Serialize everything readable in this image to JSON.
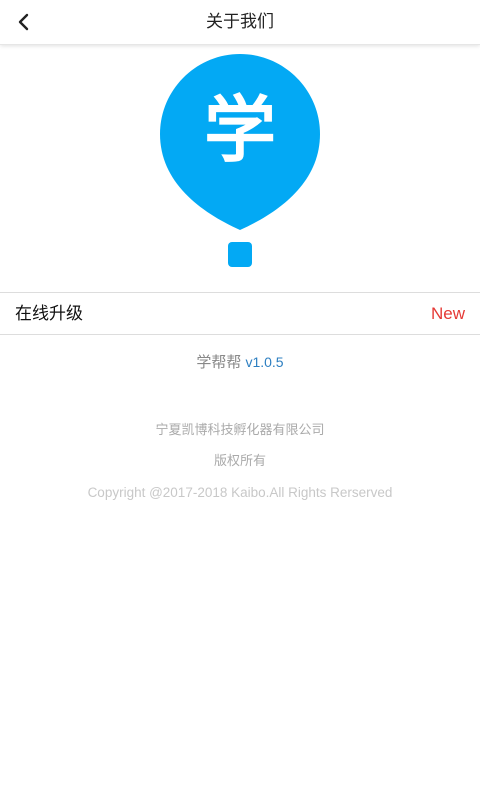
{
  "header": {
    "title": "关于我们",
    "back_icon": "chevron-left-icon"
  },
  "logo": {
    "glyph": "学",
    "color": "#03A9F4"
  },
  "upgrade_row": {
    "label": "在线升级",
    "badge": "New",
    "badge_color": "#E53935"
  },
  "app_info": {
    "name": "学帮帮",
    "version": "v1.0.5",
    "version_color": "#2D7FC1"
  },
  "footer": {
    "company": "宁夏凯博科技孵化器有限公司",
    "rights": "版权所有",
    "copyright": "Copyright @2017-2018 Kaibo.All Rights Rerserved"
  }
}
